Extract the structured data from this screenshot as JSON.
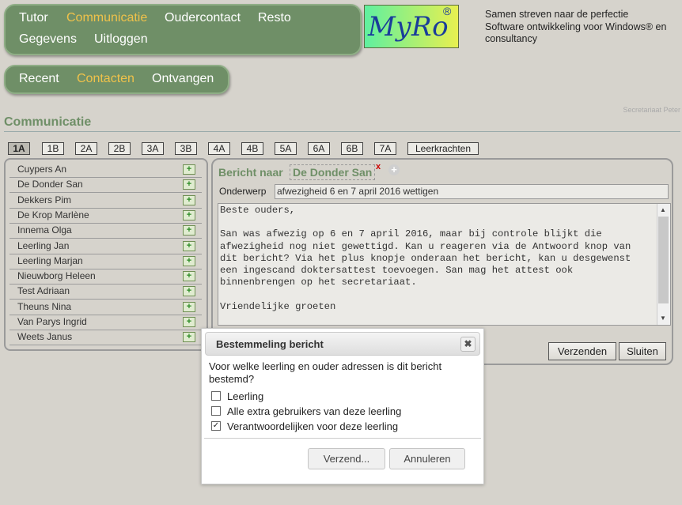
{
  "nav": {
    "main": [
      "Tutor",
      "Communicatie",
      "Oudercontact",
      "Resto",
      "Gegevens",
      "Uitloggen"
    ],
    "active_main": "Communicatie",
    "sub": [
      "Recent",
      "Contacten",
      "Ontvangen"
    ],
    "active_sub": "Contacten"
  },
  "logo": {
    "text": "MyRo",
    "reg": "®"
  },
  "tagline": [
    "Samen streven naar de perfectie",
    "Software ontwikkeling voor Windows® en",
    "consultancy"
  ],
  "user": "Secretariaat Peter",
  "page_title": "Communicatie",
  "class_tabs": [
    "1A",
    "1B",
    "2A",
    "2B",
    "3A",
    "3B",
    "4A",
    "4B",
    "5A",
    "6A",
    "6B",
    "7A",
    "Leerkrachten"
  ],
  "active_tab": "1A",
  "students": [
    "Cuypers An",
    "De Donder San",
    "Dekkers Pim",
    "De Krop Marlène",
    "Innema Olga",
    "Leerling Jan",
    "Leerling Marjan",
    "Nieuwborg Heleen",
    "Test Adriaan",
    "Theuns Nina",
    "Van Parys Ingrid",
    "Weets Janus"
  ],
  "add_icon": "+",
  "message": {
    "to_label": "Bericht naar",
    "recipient": "De Donder San",
    "remove_icon": "x",
    "add_icon": "+",
    "subject_label": "Onderwerp",
    "subject": "afwezigheid 6 en 7 april 2016 wettigen",
    "body": "Beste ouders,\n\nSan was afwezig op 6 en 7 april 2016, maar bij controle blijkt die afwezigheid nog niet gewettigd. Kan u reageren via de Antwoord knop van dit bericht? Via het plus knopje onderaan het bericht, kan u desgewenst een ingescand doktersattest toevoegen. San mag het attest ook binnenbrengen op het secretariaat.\n\nVriendelijke groeten",
    "send_label": "Verzenden",
    "close_label": "Sluiten"
  },
  "dialog": {
    "title": "Bestemmeling bericht",
    "close_icon": "✖",
    "question": "Voor welke leerling en ouder adressen is dit bericht bestemd?",
    "options": [
      {
        "label": "Leerling",
        "checked": false
      },
      {
        "label": "Alle extra gebruikers van deze leerling",
        "checked": false
      },
      {
        "label": "Verantwoordelijken voor deze leerling",
        "checked": true
      }
    ],
    "send_label": "Verzend...",
    "cancel_label": "Annuleren"
  },
  "colors": {
    "nav_bg": "#6f8f67",
    "active_nav": "#f0c24a",
    "page_bg": "#d6d3cc",
    "title_green": "#6f8f67"
  }
}
